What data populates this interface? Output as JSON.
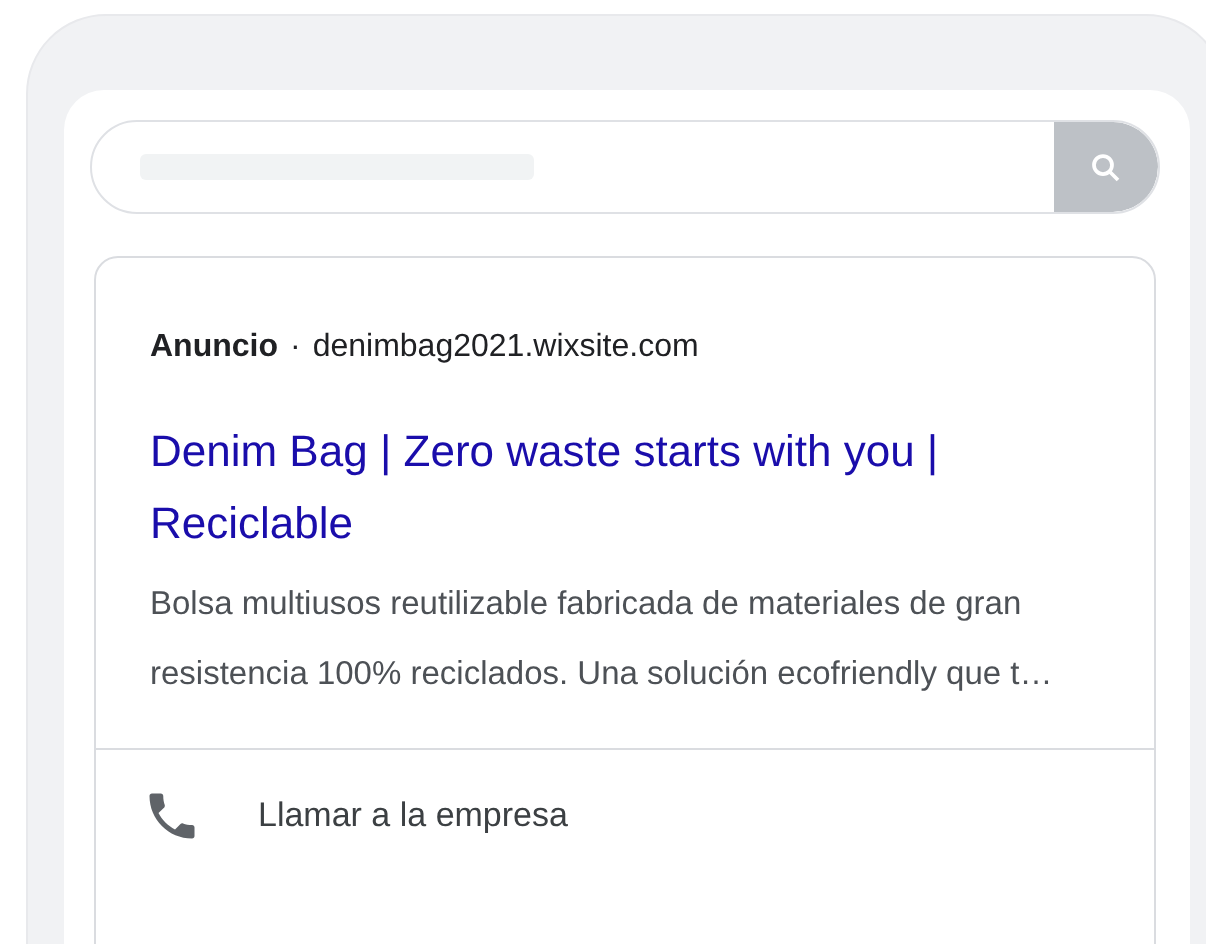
{
  "ad": {
    "label": "Anuncio",
    "separator": "·",
    "domain": "denimbag2021.wixsite.com",
    "title": "Denim Bag | Zero waste starts with you | Reciclable",
    "description": "Bolsa multiusos reutilizable fabricada de materiales de gran resistencia 100% reciclados. Una solución ecofriendly que t…",
    "action": "Llamar a la empresa"
  }
}
